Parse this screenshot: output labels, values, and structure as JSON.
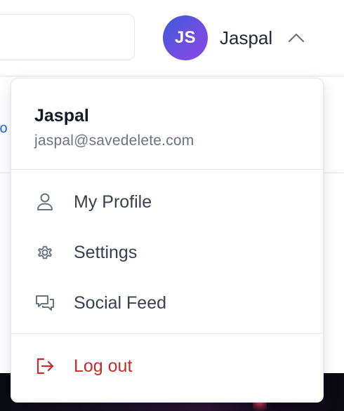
{
  "user": {
    "initials": "JS",
    "name": "Jaspal",
    "email": "jaspal@savedelete.com"
  },
  "menu": {
    "items": [
      {
        "label": "My Profile",
        "icon": "user-icon"
      },
      {
        "label": "Settings",
        "icon": "gear-icon"
      },
      {
        "label": "Social Feed",
        "icon": "chat-bubbles-icon"
      }
    ],
    "logout": {
      "label": "Log out",
      "icon": "logout-icon"
    }
  },
  "background": {
    "partial_link": "fo"
  },
  "colors": {
    "avatar_start": "#3b5bdb",
    "avatar_end": "#8b45e6",
    "danger": "#c52b2b",
    "link": "#2563eb"
  }
}
